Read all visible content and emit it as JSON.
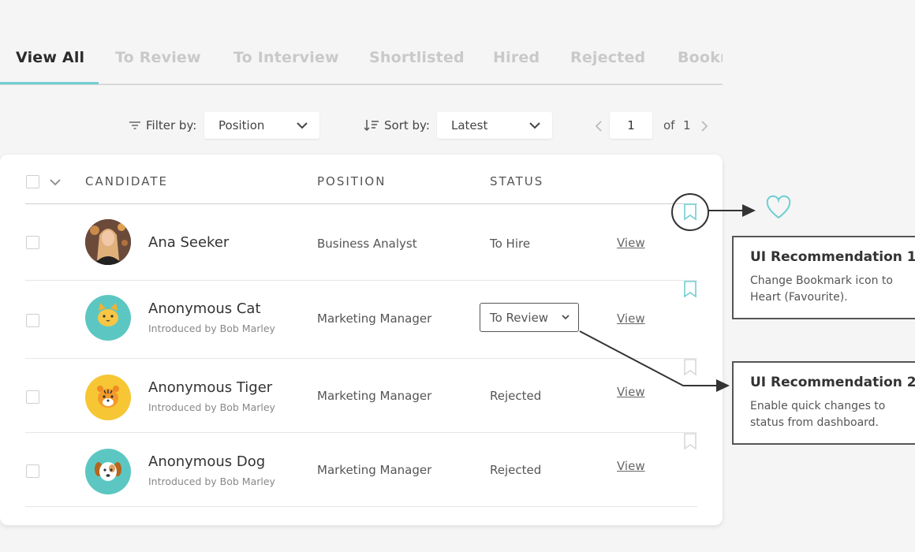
{
  "tabs": [
    "View All",
    "To Review",
    "To Interview",
    "Shortlisted",
    "Hired",
    "Rejected",
    "Bookmarked"
  ],
  "toolbar": {
    "filter_label": "Filter by:",
    "filter_value": "Position",
    "sort_label": "Sort by:",
    "sort_value": "Latest",
    "page_current": "1",
    "page_of": "of",
    "page_total": "1"
  },
  "table": {
    "headers": {
      "candidate": "CANDIDATE",
      "position": "POSITION",
      "status": "STATUS"
    },
    "rows": [
      {
        "name": "Ana Seeker",
        "intro": "",
        "position": "Business Analyst",
        "status": "To Hire",
        "view": "View",
        "avatar": "photo",
        "avatar_color": "#5a4036"
      },
      {
        "name": "Anonymous Cat",
        "intro": "Introduced by Bob Marley",
        "position": "Marketing Manager",
        "status": "To Review",
        "view": "View",
        "avatar": "cat-icon",
        "avatar_color": "#5cc7c2"
      },
      {
        "name": "Anonymous Tiger",
        "intro": "Introduced by Bob Marley",
        "position": "Marketing Manager",
        "status": "Rejected",
        "view": "View",
        "avatar": "tiger-icon",
        "avatar_color": "#f6c634"
      },
      {
        "name": "Anonymous Dog",
        "intro": "Introduced by Bob Marley",
        "position": "Marketing Manager",
        "status": "Rejected",
        "view": "View",
        "avatar": "dog-icon",
        "avatar_color": "#5cc7c2"
      }
    ]
  },
  "annotations": [
    {
      "title": "UI Recommendation 1",
      "text": "Change Bookmark icon to Heart (Favourite)."
    },
    {
      "title": "UI Recommendation 2",
      "text": "Enable quick changes to status from dashboard."
    }
  ],
  "colors": {
    "accent": "#6fcfd1",
    "bookmark_active": "#6fcfd1",
    "bookmark_inactive": "#d8d8d8"
  }
}
